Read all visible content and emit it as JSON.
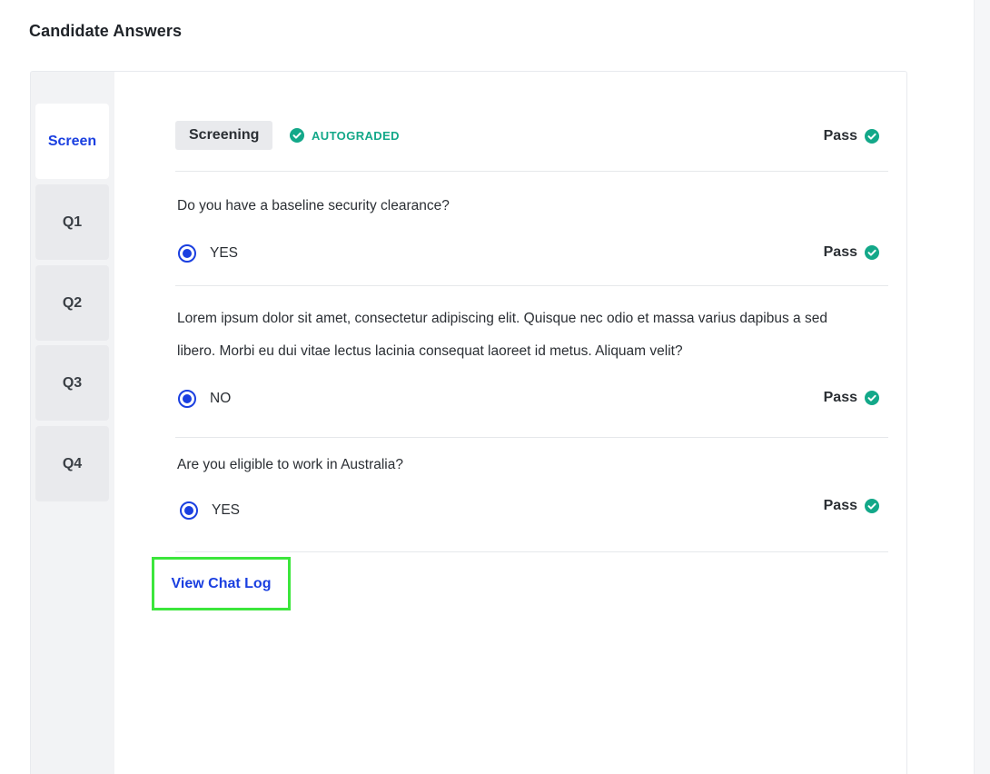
{
  "page": {
    "title": "Candidate Answers"
  },
  "tabs": [
    {
      "label": "Screen",
      "active": true
    },
    {
      "label": "Q1",
      "active": false
    },
    {
      "label": "Q2",
      "active": false
    },
    {
      "label": "Q3",
      "active": false
    },
    {
      "label": "Q4",
      "active": false
    }
  ],
  "section": {
    "name": "Screening",
    "autograded_label": "AUTOGRADED",
    "result": "Pass"
  },
  "questions": [
    {
      "text": "Do you have a baseline security clearance?",
      "answer": "YES",
      "result": "Pass"
    },
    {
      "text_line1": "Lorem ipsum dolor sit amet, consectetur adipiscing elit. Quisque nec odio et massa varius dapibus a sed",
      "text_line2": "libero. Morbi eu dui vitae lectus lacinia consequat laoreet id metus. Aliquam velit?",
      "answer": "NO",
      "result": "Pass"
    },
    {
      "text": "Are you eligible to work in Australia?",
      "answer": "YES",
      "result": "Pass"
    }
  ],
  "actions": {
    "view_chat_log": "View Chat Log"
  },
  "colors": {
    "accent": "#1a3fe0",
    "pass_green": "#13a889",
    "highlight_border": "#3ce63c"
  },
  "icons": {
    "check": "check-circle-icon",
    "radio": "radio-selected-icon"
  }
}
